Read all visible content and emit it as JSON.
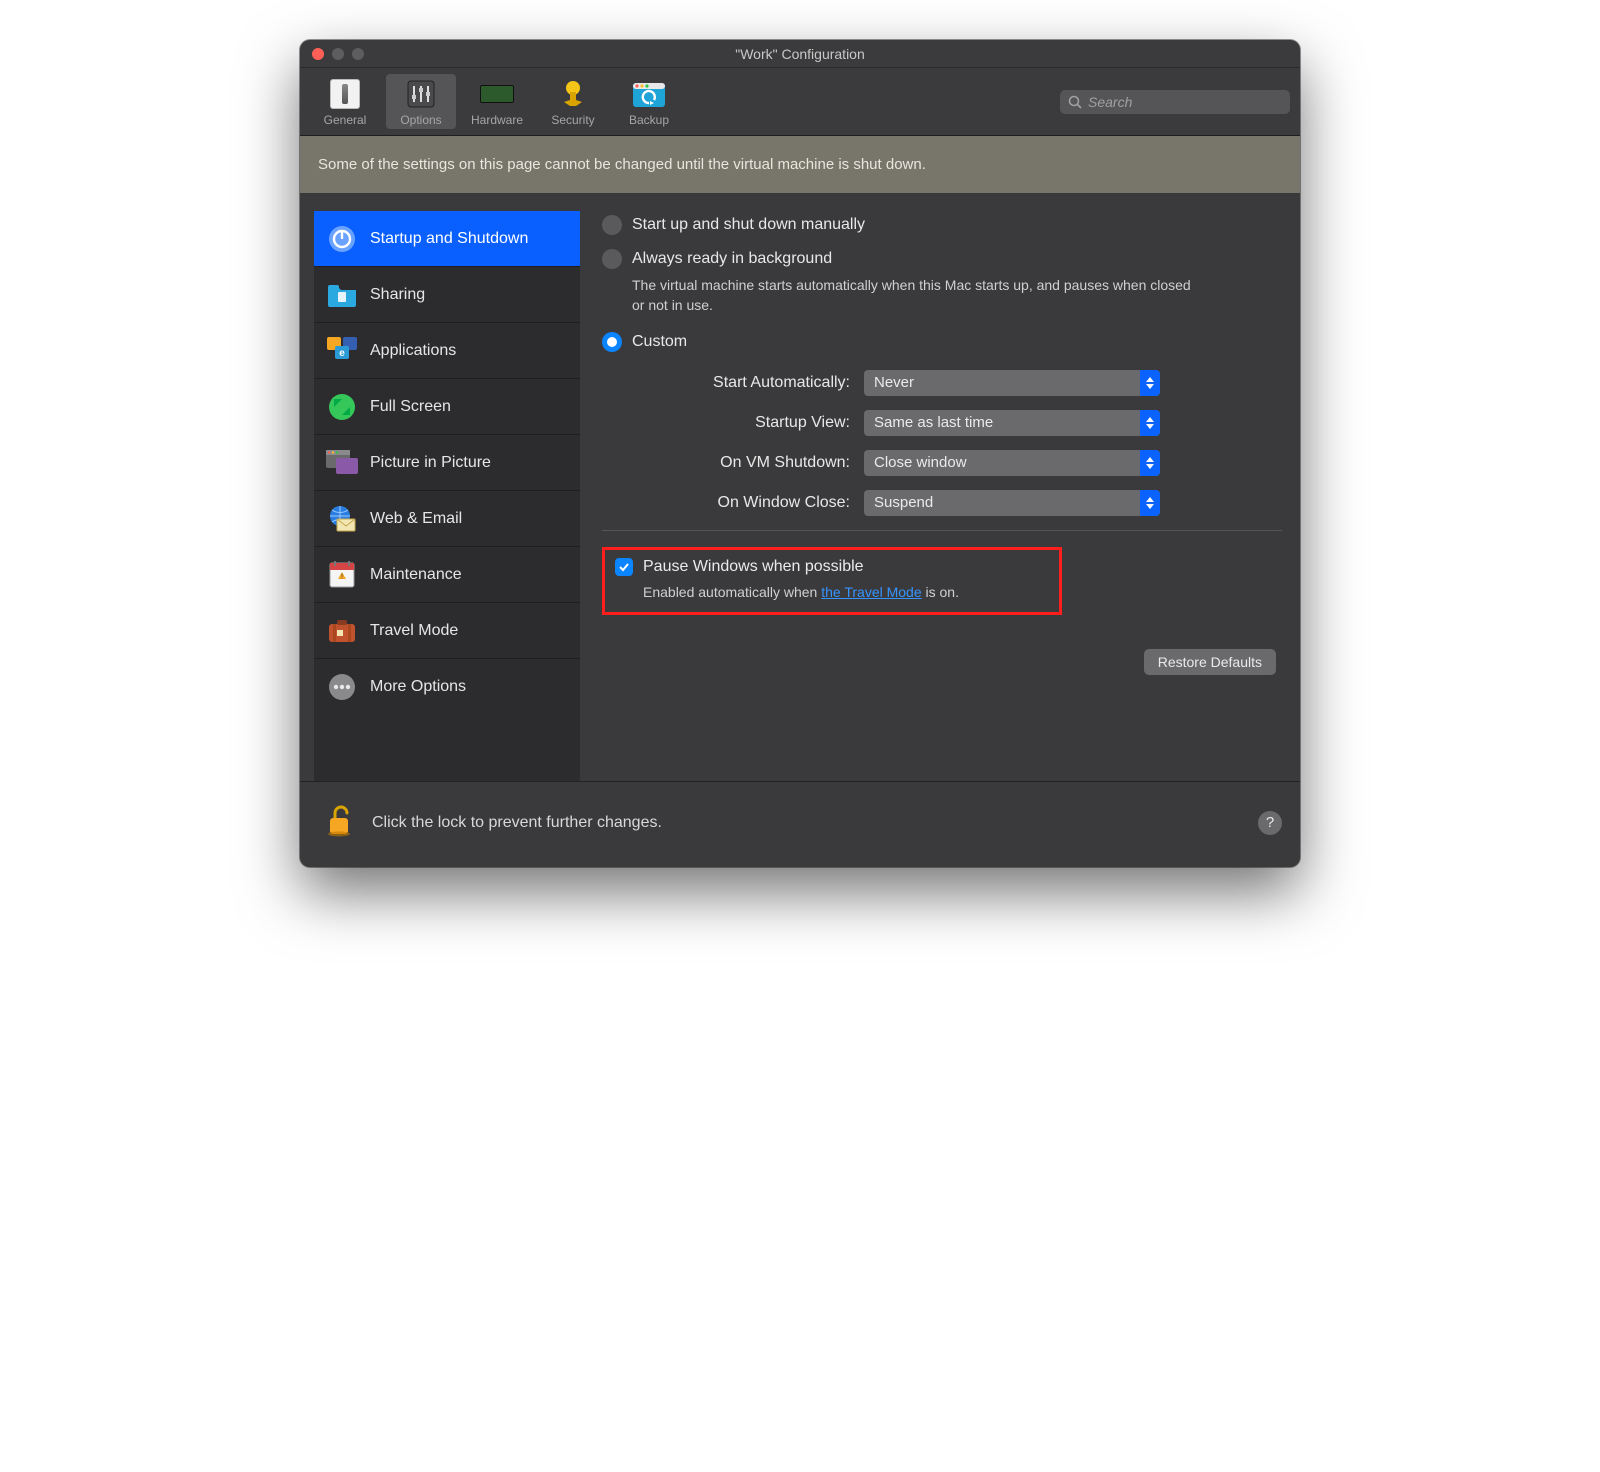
{
  "window": {
    "title": "\"Work\" Configuration"
  },
  "toolbar": {
    "items": [
      {
        "label": "General"
      },
      {
        "label": "Options"
      },
      {
        "label": "Hardware"
      },
      {
        "label": "Security"
      },
      {
        "label": "Backup"
      }
    ],
    "search_placeholder": "Search"
  },
  "banner": "Some of the settings on this page cannot be changed until the virtual machine is shut down.",
  "sidebar": {
    "items": [
      {
        "label": "Startup and Shutdown"
      },
      {
        "label": "Sharing"
      },
      {
        "label": "Applications"
      },
      {
        "label": "Full Screen"
      },
      {
        "label": "Picture in Picture"
      },
      {
        "label": "Web & Email"
      },
      {
        "label": "Maintenance"
      },
      {
        "label": "Travel Mode"
      },
      {
        "label": "More Options"
      }
    ]
  },
  "pane": {
    "radios": {
      "r0": "Start up and shut down manually",
      "r1": "Always ready in background",
      "r1_sub": "The virtual machine starts automatically when this Mac starts up, and pauses when closed or not in use.",
      "r2": "Custom"
    },
    "fields": {
      "start_auto_label": "Start Automatically:",
      "start_auto_value": "Never",
      "startup_view_label": "Startup View:",
      "startup_view_value": "Same as last time",
      "on_shutdown_label": "On VM Shutdown:",
      "on_shutdown_value": "Close window",
      "on_close_label": "On Window Close:",
      "on_close_value": "Suspend"
    },
    "pause": {
      "label": "Pause Windows when possible",
      "sub_prefix": "Enabled automatically when ",
      "sub_link": "the Travel Mode",
      "sub_suffix": " is on."
    },
    "restore": "Restore Defaults"
  },
  "footer": {
    "lock_text": "Click the lock to prevent further changes.",
    "help": "?"
  }
}
